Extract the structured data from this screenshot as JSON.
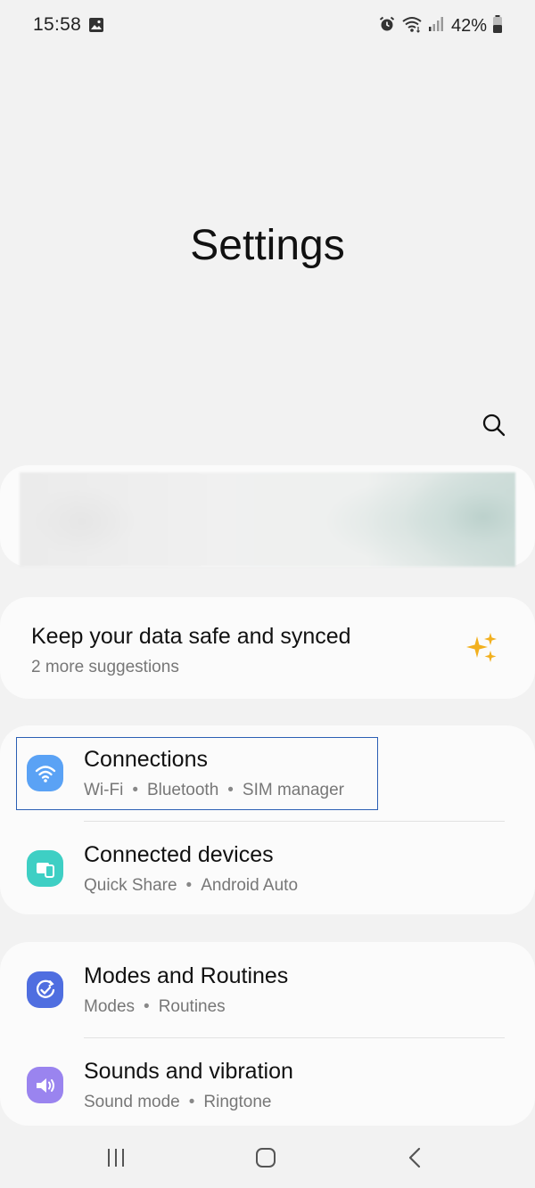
{
  "status_bar": {
    "time": "15:58",
    "battery_percent": "42%",
    "icons": [
      "gallery-icon",
      "alarm-icon",
      "wifi-icon",
      "signal-icon",
      "battery-icon"
    ]
  },
  "page": {
    "title": "Settings"
  },
  "colors": {
    "background": "#f2f2f2",
    "card": "#fbfbfb",
    "connections_icon": "#5aa2f5",
    "connected_devices_icon": "#3ecfc4",
    "modes_icon": "#4f6ee0",
    "sounds_icon": "#9a84ef",
    "sparkle": "#f2b01e",
    "focus_outline": "#2b5fb4"
  },
  "suggestion": {
    "title": "Keep your data safe and synced",
    "subtitle": "2 more suggestions"
  },
  "settings": [
    {
      "title": "Connections",
      "subtitles": [
        "Wi-Fi",
        "Bluetooth",
        "SIM manager"
      ],
      "icon": "wifi-icon"
    },
    {
      "title": "Connected devices",
      "subtitles": [
        "Quick Share",
        "Android Auto"
      ],
      "icon": "devices-icon"
    },
    {
      "title": "Modes and Routines",
      "subtitles": [
        "Modes",
        "Routines"
      ],
      "icon": "check-circle-icon"
    },
    {
      "title": "Sounds and vibration",
      "subtitles": [
        "Sound mode",
        "Ringtone"
      ],
      "icon": "speaker-icon"
    }
  ],
  "separator": "•"
}
